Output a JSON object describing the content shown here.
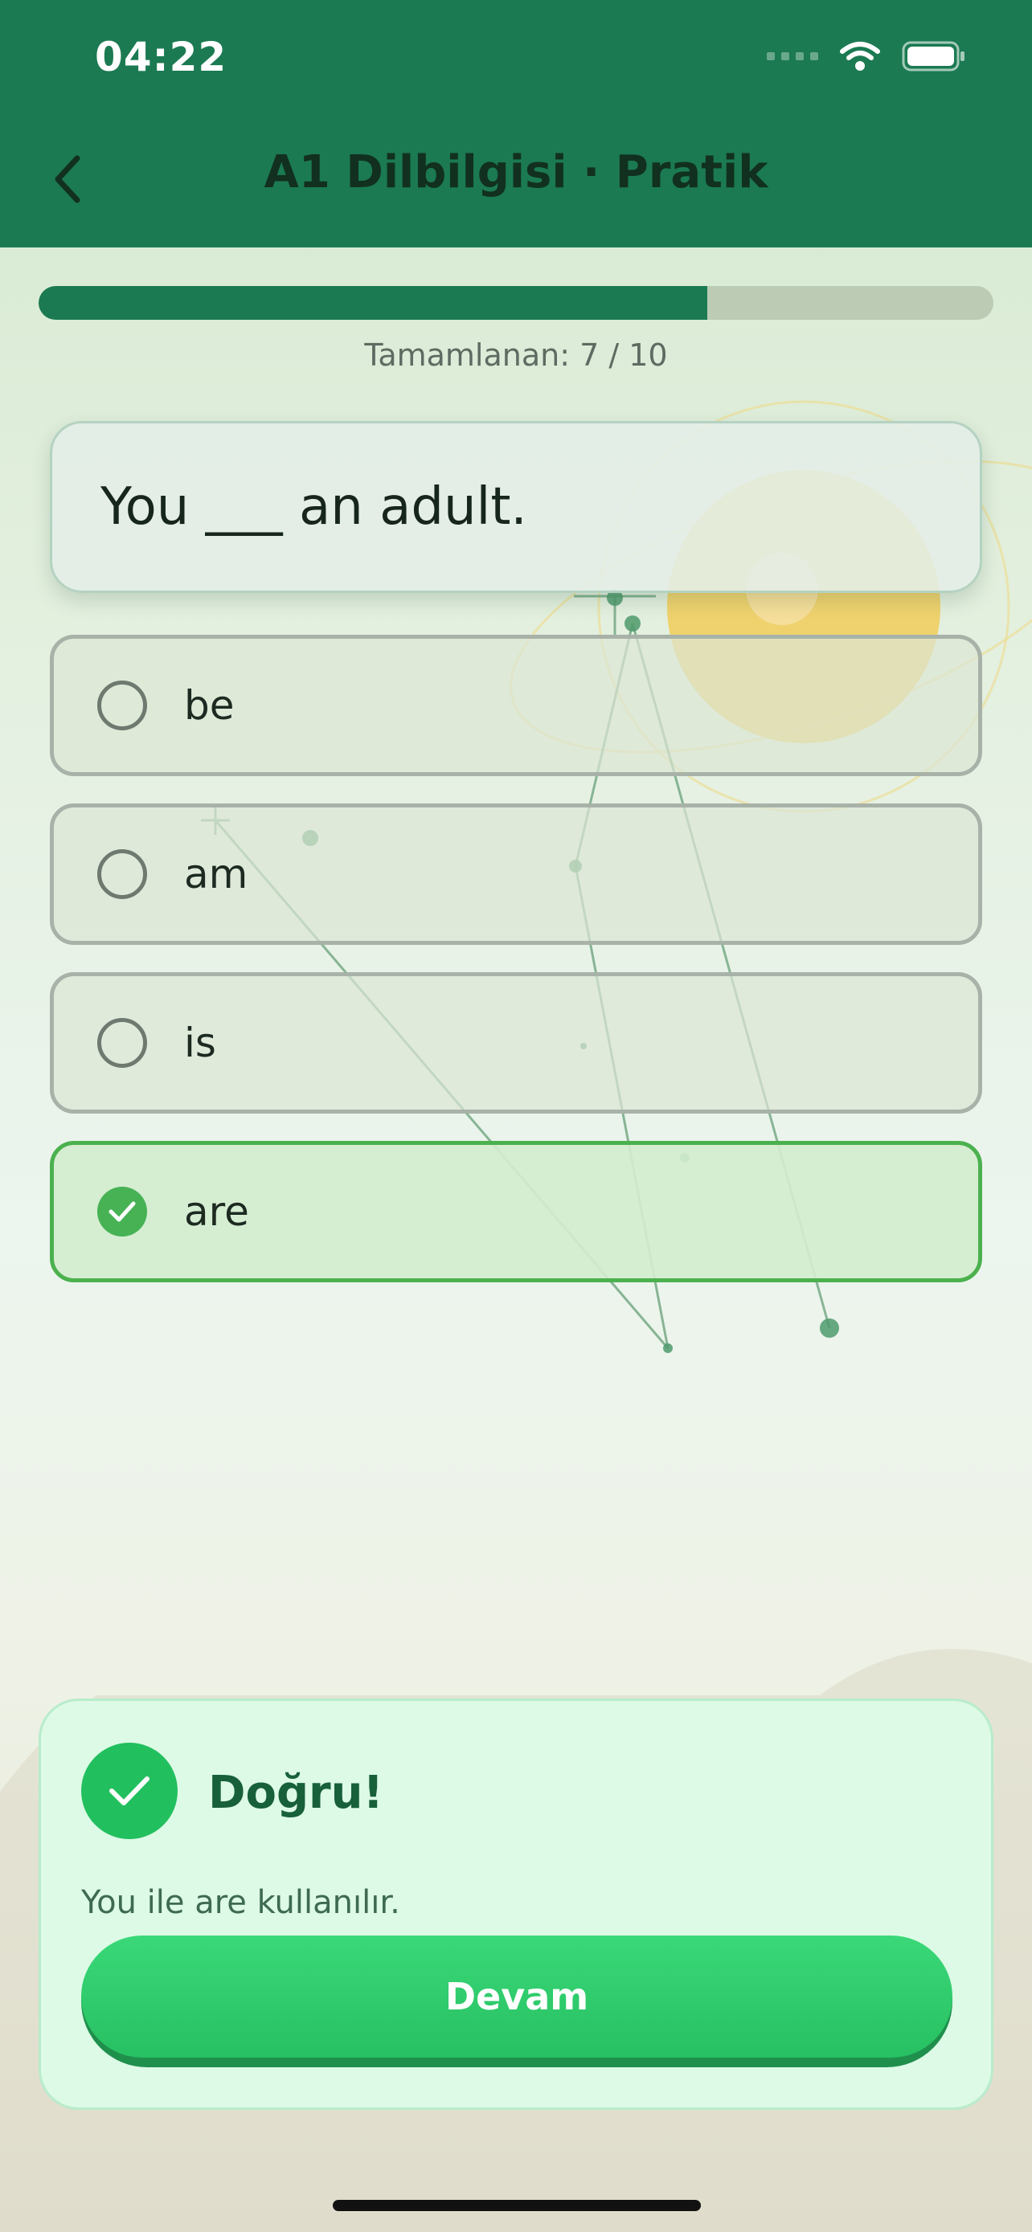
{
  "status_bar": {
    "time": "04:22"
  },
  "header": {
    "title": "A1 Dilbilgisi · Pratik",
    "back_icon": "chevron-left-icon"
  },
  "progress": {
    "label": "Tamamlanan: 7 / 10",
    "fraction": 0.7
  },
  "question": {
    "text": "You ___ an adult."
  },
  "options": [
    {
      "label": "be",
      "selected": false
    },
    {
      "label": "am",
      "selected": false
    },
    {
      "label": "is",
      "selected": false
    },
    {
      "label": "are",
      "selected": true
    }
  ],
  "feedback": {
    "title": "Doğru!",
    "explanation": "You ile are kullanılır.",
    "continue_label": "Devam"
  },
  "colors": {
    "header": "#1b7a52",
    "progress_fill": "#1b7a52",
    "correct": "#22bf5e",
    "selected_border": "#4bb14e",
    "feedback_bg": "#dcfae6"
  }
}
